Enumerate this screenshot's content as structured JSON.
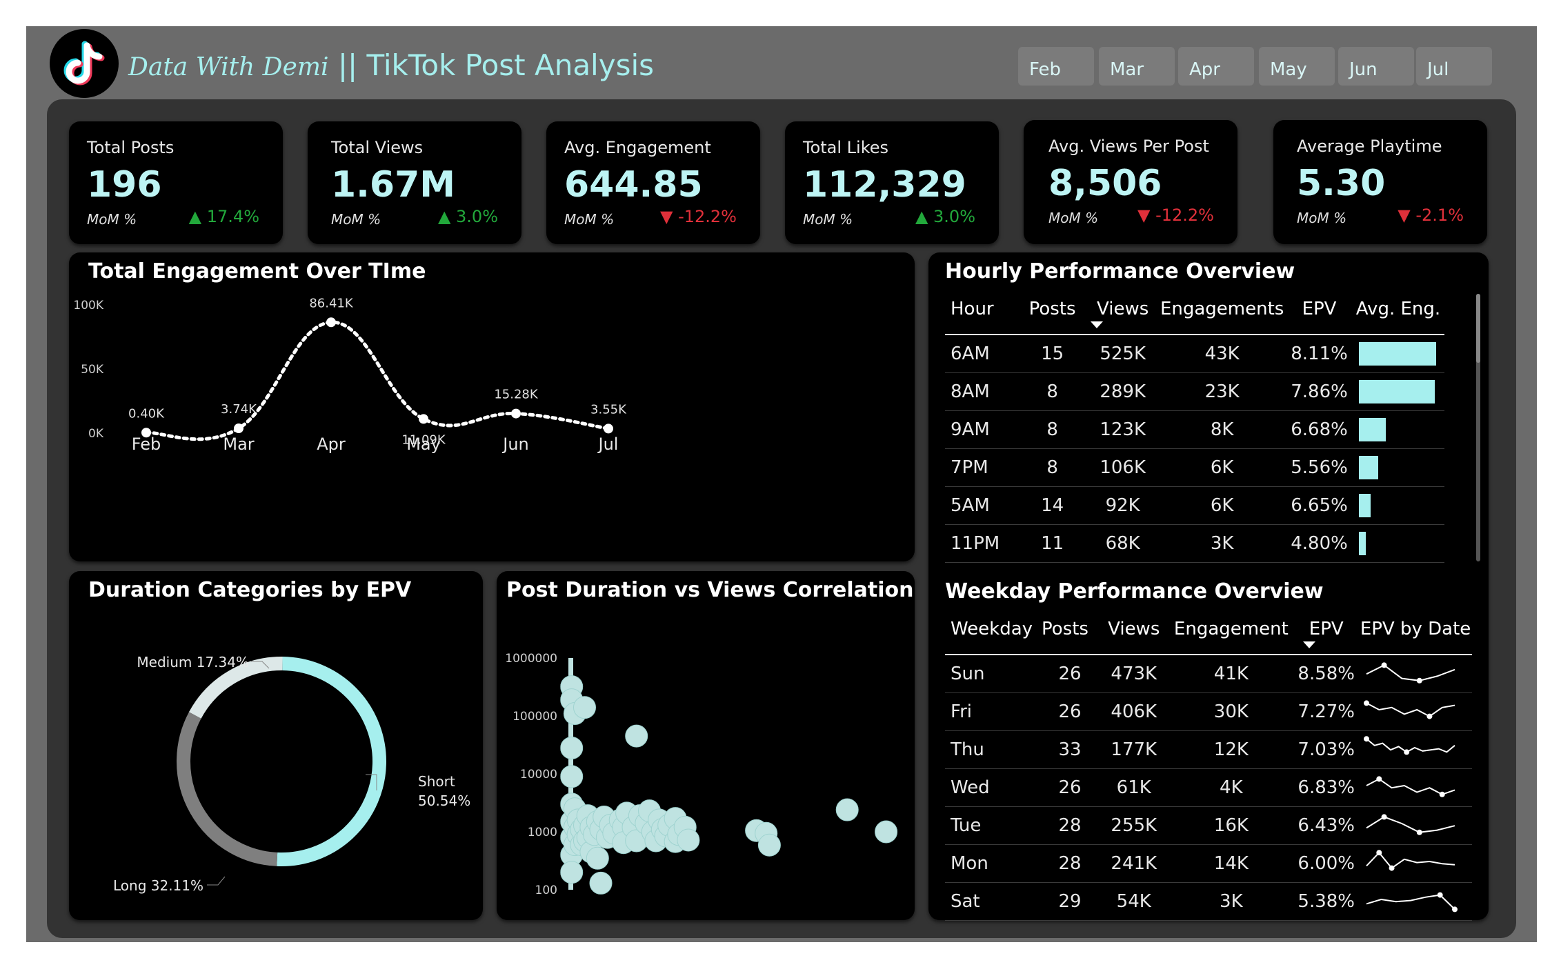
{
  "header": {
    "brand": "Data With Demi",
    "title": " || TikTok Post Analysis",
    "logo_icon": "tiktok-logo",
    "months": [
      "Feb",
      "Mar",
      "Apr",
      "May",
      "Jun",
      "Jul"
    ]
  },
  "kpis": [
    {
      "label": "Total Posts",
      "value": "196",
      "mom_label": "MoM %",
      "delta": "▲ 17.4%",
      "dir": "up"
    },
    {
      "label": "Total Views",
      "value": "1.67M",
      "mom_label": "MoM %",
      "delta": "▲ 3.0%",
      "dir": "up"
    },
    {
      "label": "Avg. Engagement",
      "value": "644.85",
      "mom_label": "MoM %",
      "delta": "▼ -12.2%",
      "dir": "down"
    },
    {
      "label": "Total Likes",
      "value": "112,329",
      "mom_label": "MoM %",
      "delta": "▲ 3.0%",
      "dir": "up"
    },
    {
      "label": "Avg. Views Per Post",
      "value": "8,506",
      "mom_label": "MoM %",
      "delta": "▼ -12.2%",
      "dir": "down"
    },
    {
      "label": "Average Playtime",
      "value": "5.30",
      "mom_label": "MoM %",
      "delta": "▼ -2.1%",
      "dir": "down"
    }
  ],
  "colors": {
    "accent": "#a6efee",
    "up": "#22a83b",
    "down": "#e0303a",
    "card": "#000000"
  },
  "chart_data": [
    {
      "type": "line",
      "title": "Total Engagement Over TIme",
      "x": [
        "Feb",
        "Mar",
        "Apr",
        "May",
        "Jun",
        "Jul"
      ],
      "values": [
        400,
        3740,
        86410,
        11090,
        15280,
        3550
      ],
      "labels": [
        "0.40K",
        "3.74K",
        "86.41K",
        "11.09K",
        "15.28K",
        "3.55K"
      ],
      "y_ticks": [
        "0K",
        "50K",
        "100K"
      ],
      "ylim": [
        0,
        100000
      ]
    },
    {
      "type": "pie",
      "title": "Duration Categories by EPV",
      "slices": [
        {
          "name": "Short",
          "value": 50.54,
          "label": "50.54%",
          "color": "#a6efee"
        },
        {
          "name": "Long",
          "value": 32.11,
          "label": "Long 32.11%",
          "color": "#7f7f7f"
        },
        {
          "name": "Medium",
          "value": 17.34,
          "label": "Medium 17.34%",
          "color": "#dde8e8"
        }
      ]
    },
    {
      "type": "scatter",
      "title": "Post Duration vs Views Correlation",
      "x_ticks": [
        "0",
        "50",
        "100"
      ],
      "y_ticks": [
        "100",
        "1000",
        "10000",
        "100000",
        "1000000"
      ],
      "xlim": [
        0,
        100
      ],
      "ylim": [
        100,
        1000000
      ],
      "y_scale": "log",
      "points": [
        {
          "x": 1,
          "y": 320000
        },
        {
          "x": 1,
          "y": 190000
        },
        {
          "x": 1,
          "y": 28000
        },
        {
          "x": 1,
          "y": 9000
        },
        {
          "x": 1,
          "y": 3000
        },
        {
          "x": 1,
          "y": 1500
        },
        {
          "x": 1,
          "y": 800
        },
        {
          "x": 1,
          "y": 400
        },
        {
          "x": 1,
          "y": 200
        },
        {
          "x": 2,
          "y": 110000
        },
        {
          "x": 2,
          "y": 2500
        },
        {
          "x": 2,
          "y": 1200
        },
        {
          "x": 2,
          "y": 600
        },
        {
          "x": 3,
          "y": 1600
        },
        {
          "x": 3,
          "y": 900
        },
        {
          "x": 4,
          "y": 600
        },
        {
          "x": 4,
          "y": 1100
        },
        {
          "x": 5,
          "y": 140000
        },
        {
          "x": 5,
          "y": 1300
        },
        {
          "x": 5,
          "y": 700
        },
        {
          "x": 6,
          "y": 1900
        },
        {
          "x": 6,
          "y": 800
        },
        {
          "x": 7,
          "y": 1200
        },
        {
          "x": 7,
          "y": 450
        },
        {
          "x": 8,
          "y": 900
        },
        {
          "x": 9,
          "y": 1500
        },
        {
          "x": 9,
          "y": 350
        },
        {
          "x": 10,
          "y": 130
        },
        {
          "x": 10,
          "y": 1100
        },
        {
          "x": 11,
          "y": 1800
        },
        {
          "x": 12,
          "y": 800
        },
        {
          "x": 13,
          "y": 1300
        },
        {
          "x": 14,
          "y": 950
        },
        {
          "x": 16,
          "y": 1600
        },
        {
          "x": 17,
          "y": 1200
        },
        {
          "x": 17,
          "y": 650
        },
        {
          "x": 18,
          "y": 2100
        },
        {
          "x": 20,
          "y": 1200
        },
        {
          "x": 21,
          "y": 45000
        },
        {
          "x": 21,
          "y": 700
        },
        {
          "x": 22,
          "y": 1900
        },
        {
          "x": 24,
          "y": 1400
        },
        {
          "x": 25,
          "y": 2300
        },
        {
          "x": 26,
          "y": 1000
        },
        {
          "x": 27,
          "y": 700
        },
        {
          "x": 28,
          "y": 1600
        },
        {
          "x": 29,
          "y": 1100
        },
        {
          "x": 30,
          "y": 850
        },
        {
          "x": 31,
          "y": 1300
        },
        {
          "x": 33,
          "y": 1700
        },
        {
          "x": 33,
          "y": 680
        },
        {
          "x": 34,
          "y": 900
        },
        {
          "x": 36,
          "y": 1200
        },
        {
          "x": 37,
          "y": 720
        },
        {
          "x": 58,
          "y": 1050
        },
        {
          "x": 61,
          "y": 940
        },
        {
          "x": 62,
          "y": 590
        },
        {
          "x": 86,
          "y": 2400
        },
        {
          "x": 98,
          "y": 1000
        }
      ]
    }
  ],
  "hourly": {
    "title": "Hourly Performance Overview",
    "columns": [
      "Hour",
      "Posts",
      "Views",
      "Engagements",
      "EPV",
      "Avg. Eng."
    ],
    "rows": [
      {
        "hour": "6AM",
        "posts": "15",
        "views": "525K",
        "eng": "43K",
        "epv": "8.11%",
        "avg": 1.0
      },
      {
        "hour": "8AM",
        "posts": "8",
        "views": "289K",
        "eng": "23K",
        "epv": "7.86%",
        "avg": 0.98
      },
      {
        "hour": "9AM",
        "posts": "8",
        "views": "123K",
        "eng": "8K",
        "epv": "6.68%",
        "avg": 0.35
      },
      {
        "hour": "7PM",
        "posts": "8",
        "views": "106K",
        "eng": "6K",
        "epv": "5.56%",
        "avg": 0.25
      },
      {
        "hour": "5AM",
        "posts": "14",
        "views": "92K",
        "eng": "6K",
        "epv": "6.65%",
        "avg": 0.15
      },
      {
        "hour": "11PM",
        "posts": "11",
        "views": "68K",
        "eng": "3K",
        "epv": "4.80%",
        "avg": 0.09
      }
    ]
  },
  "weekday": {
    "title": "Weekday Performance Overview",
    "columns": [
      "Weekday",
      "Posts",
      "Views",
      "Engagement",
      "EPV",
      "EPV by Date"
    ],
    "rows": [
      {
        "day": "Sun",
        "posts": "26",
        "views": "473K",
        "eng": "41K",
        "epv": "8.58%",
        "spark": [
          0.4,
          0.8,
          0.2,
          0.1,
          0.3,
          0.6
        ]
      },
      {
        "day": "Fri",
        "posts": "26",
        "views": "406K",
        "eng": "30K",
        "epv": "7.27%",
        "spark": [
          0.8,
          0.5,
          0.6,
          0.3,
          0.5,
          0.2,
          0.6,
          0.7
        ]
      },
      {
        "day": "Thu",
        "posts": "33",
        "views": "177K",
        "eng": "12K",
        "epv": "7.03%",
        "spark": [
          0.9,
          0.6,
          0.7,
          0.4,
          0.55,
          0.3,
          0.5,
          0.35,
          0.4,
          0.45,
          0.3,
          0.6
        ]
      },
      {
        "day": "Wed",
        "posts": "26",
        "views": "61K",
        "eng": "4K",
        "epv": "6.83%",
        "spark": [
          0.5,
          0.8,
          0.4,
          0.5,
          0.2,
          0.4,
          0.1,
          0.3
        ]
      },
      {
        "day": "Tue",
        "posts": "28",
        "views": "255K",
        "eng": "16K",
        "epv": "6.43%",
        "spark": [
          0.3,
          0.8,
          0.5,
          0.1,
          0.2,
          0.4
        ]
      },
      {
        "day": "Mon",
        "posts": "28",
        "views": "241K",
        "eng": "14K",
        "epv": "6.00%",
        "spark": [
          0.3,
          0.9,
          0.2,
          0.6,
          0.45,
          0.5,
          0.4,
          0.35
        ]
      },
      {
        "day": "Sat",
        "posts": "29",
        "views": "54K",
        "eng": "3K",
        "epv": "5.38%",
        "spark": [
          0.3,
          0.5,
          0.4,
          0.45,
          0.6,
          0.7,
          0.05
        ]
      }
    ]
  }
}
